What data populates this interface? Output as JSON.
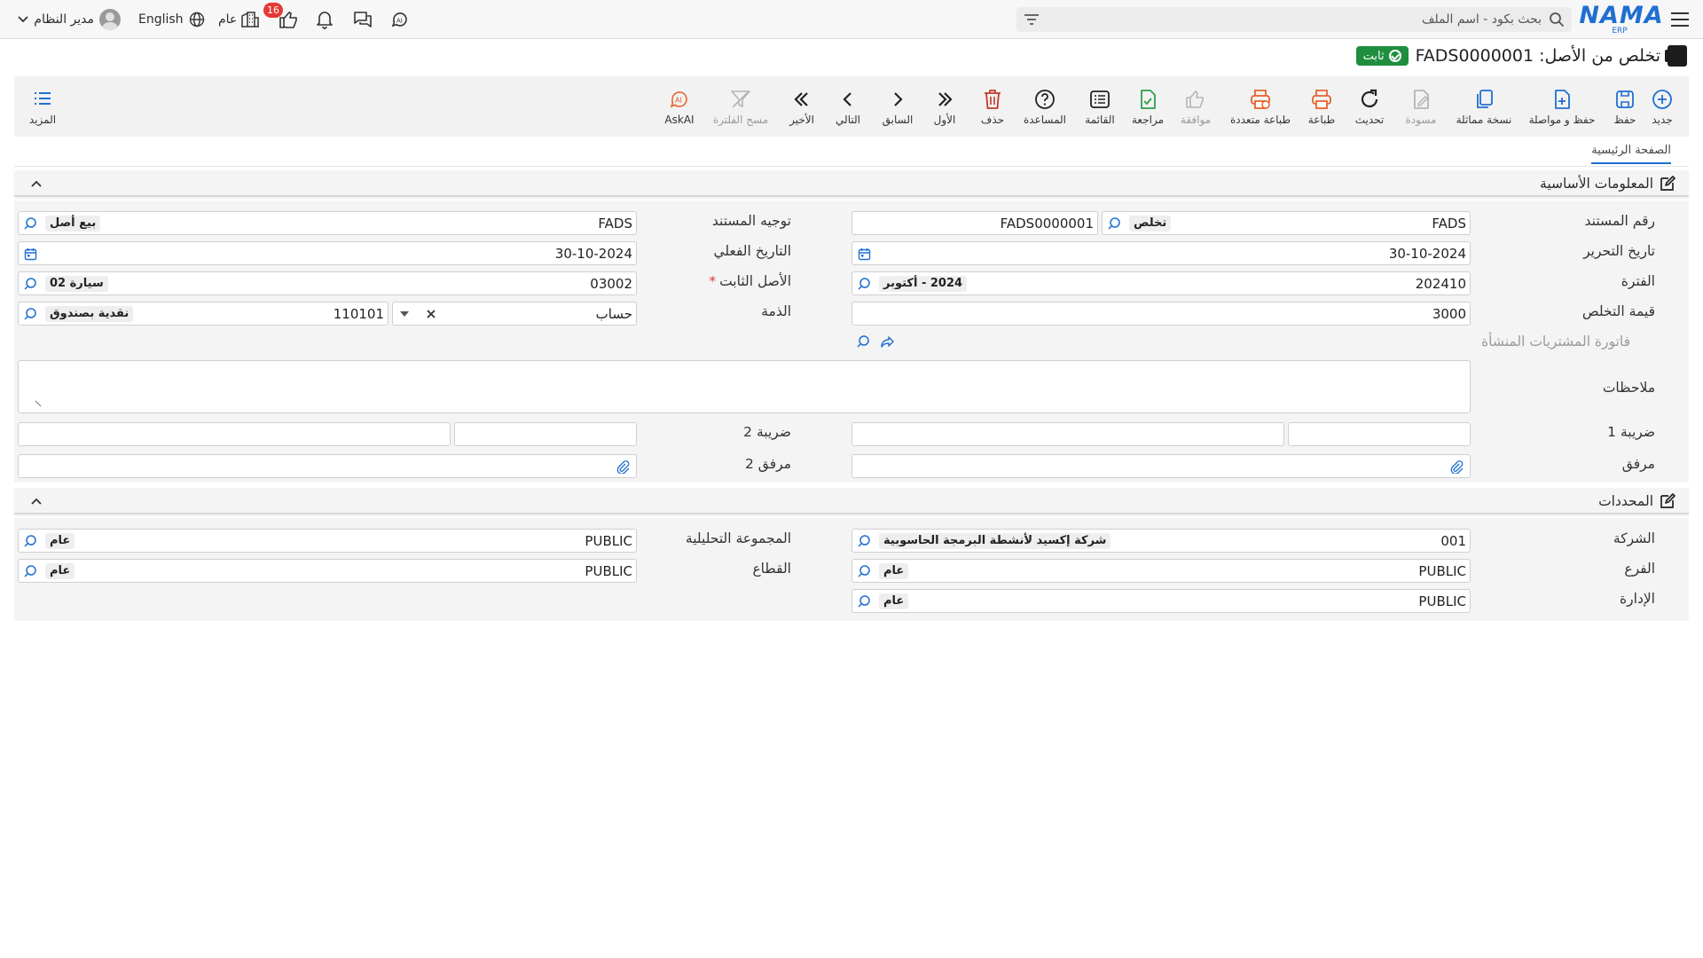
{
  "header": {
    "logo_text": "NAMA",
    "logo_sub": "ERP",
    "search_placeholder": "بحث بكود - اسم الملف",
    "user_name": "مدير النظام",
    "language": "English",
    "scope": "عام",
    "likes_count": "16"
  },
  "page": {
    "title": "تخلص من الأصل: FADS0000001",
    "status": "ثابت"
  },
  "toolbar": {
    "new": "جديد",
    "save": "حفظ",
    "save_continue": "حفظ و مواصلة",
    "duplicate": "نسخة مماثلة",
    "draft": "مسودة",
    "refresh": "تحديث",
    "print": "طباعة",
    "multi_print": "طباعة متعددة",
    "approve": "موافقة",
    "review": "مراجعة",
    "list": "القائمة",
    "help": "المساعدة",
    "delete": "حذف",
    "first": "الأول",
    "previous": "السابق",
    "next": "التالي",
    "last": "الأخير",
    "clear_filter": "مسح الفلترة",
    "askai": "AskAI",
    "more": "المزيد"
  },
  "tabs": {
    "main": "الصفحة الرئيسية"
  },
  "basic": {
    "section_title": "المعلومات الأساسية",
    "doc_number": {
      "label": "رقم المستند",
      "prefix": "FADS",
      "type_chip": "تخلص",
      "number": "FADS0000001"
    },
    "doc_direction": {
      "label": "توجيه المستند",
      "value": "FADS",
      "chip": "بيع أصل"
    },
    "issue_date": {
      "label": "تاريخ التحرير",
      "value": "30-10-2024"
    },
    "actual_date": {
      "label": "التاريخ الفعلي",
      "value": "30-10-2024"
    },
    "period": {
      "label": "الفترة",
      "value": "202410",
      "chip": "2024 - أكتوبر"
    },
    "fixed_asset": {
      "label": "الأصل الثابت",
      "value": "03002",
      "chip": "سيارة 02",
      "required_mark": "*"
    },
    "disposal_value": {
      "label": "قيمة التخلص",
      "value": "3000"
    },
    "liability": {
      "label": "الذمة",
      "type": "حساب",
      "value": "110101",
      "chip": "نقدية بصندوق"
    },
    "origin_invoice": {
      "label": "فاتورة المشتريات المنشأة"
    },
    "notes": {
      "label": "ملاحظات",
      "value": ""
    },
    "tax1": {
      "label": "ضريبة 1"
    },
    "tax2": {
      "label": "ضريبة 2"
    },
    "attachment": {
      "label": "مرفق"
    },
    "attachment2": {
      "label": "مرفق 2"
    }
  },
  "dims": {
    "section_title": "المحددات",
    "company": {
      "label": "الشركة",
      "value": "001",
      "chip": "شركة إكسيد لأنشطة البرمجة الحاسوبية"
    },
    "analysis_group": {
      "label": "المجموعة التحليلية",
      "value": "PUBLIC",
      "chip": "عام"
    },
    "branch": {
      "label": "الفرع",
      "value": "PUBLIC",
      "chip": "عام"
    },
    "sector": {
      "label": "القطاع",
      "value": "PUBLIC",
      "chip": "عام"
    },
    "department": {
      "label": "الإدارة",
      "value": "PUBLIC",
      "chip": "عام"
    }
  },
  "colors": {
    "accent": "#1f6fd1",
    "status_green": "#1e8e3e",
    "badge_red": "#e53935",
    "danger": "#c0392b",
    "orange": "#e8622c",
    "green_icon": "#2e9e4e"
  }
}
